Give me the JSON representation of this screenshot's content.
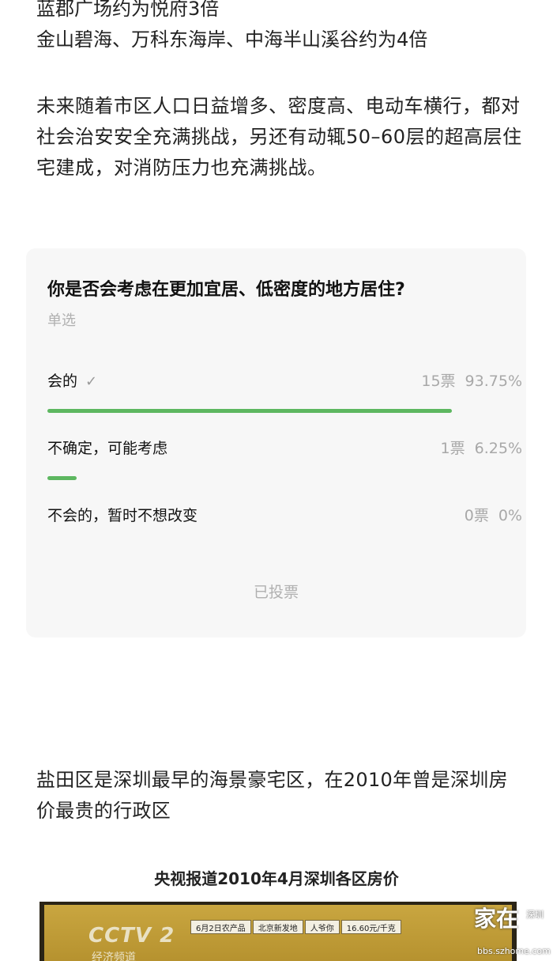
{
  "article": {
    "top_lines": [
      "蓝郡广场约为悦府3倍",
      "金山碧海、万科东海岸、中海半山溪谷约为4倍"
    ],
    "paragraph_1": "未来随着市区人口日益增多、密度高、电动车横行，都对社会治安安全充满挑战，另还有动辄50–60层的超高层住宅建成，对消防压力也充满挑战。",
    "paragraph_2": "盐田区是深圳最早的海景豪宅区，在2010年曾是深圳房价最贵的行政区"
  },
  "poll": {
    "question": "你是否会考虑在更加宜居、低密度的地方居住?",
    "type_label": "单选",
    "options": [
      {
        "label": "会的",
        "votes": "15票",
        "percent": "93.75%",
        "fraction": 0.9375,
        "selected": true,
        "check_icon": "✓"
      },
      {
        "label": "不确定，可能考虑",
        "votes": "1票",
        "percent": "6.25%",
        "fraction": 0.0625,
        "selected": false
      },
      {
        "label": "不会的，暂时不想改变",
        "votes": "0票",
        "percent": "0%",
        "fraction": 0,
        "selected": false
      }
    ],
    "voted_label": "已投票",
    "bar_color": "#5db760"
  },
  "image": {
    "caption": "央视报道2010年4月深圳各区房价",
    "logo_text": "CCTV 2",
    "logo_sub": "经济频道",
    "ticker": [
      "6月2日农产品",
      "北京新发地",
      "人爷你",
      "16.60元/千克"
    ],
    "watermark_main": "家在",
    "watermark_side": "深圳",
    "watermark_url": "bbs.szhome.com"
  }
}
